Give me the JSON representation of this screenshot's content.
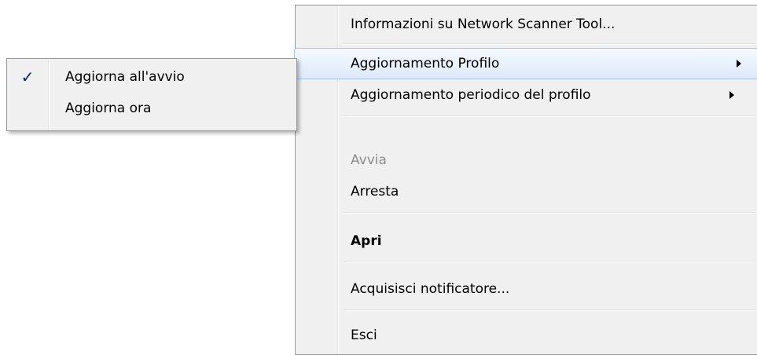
{
  "main_menu": {
    "about": "Informazioni su Network Scanner Tool...",
    "profile_update": "Aggiornamento Profilo",
    "periodic_update": "Aggiornamento periodico del profilo",
    "start": "Avvia",
    "stop": "Arresta",
    "open": "Apri",
    "acquire_notifier": "Acquisisci notificatore...",
    "exit": "Esci"
  },
  "submenu": {
    "update_at_startup": "Aggiorna all'avvio",
    "update_at_startup_checked": true,
    "update_now": "Aggiorna ora",
    "check_glyph": "✓"
  },
  "colors": {
    "menu_background": "#f0f0f0",
    "highlight_border": "#a8c7ee",
    "disabled_text": "#8d8d8d"
  }
}
